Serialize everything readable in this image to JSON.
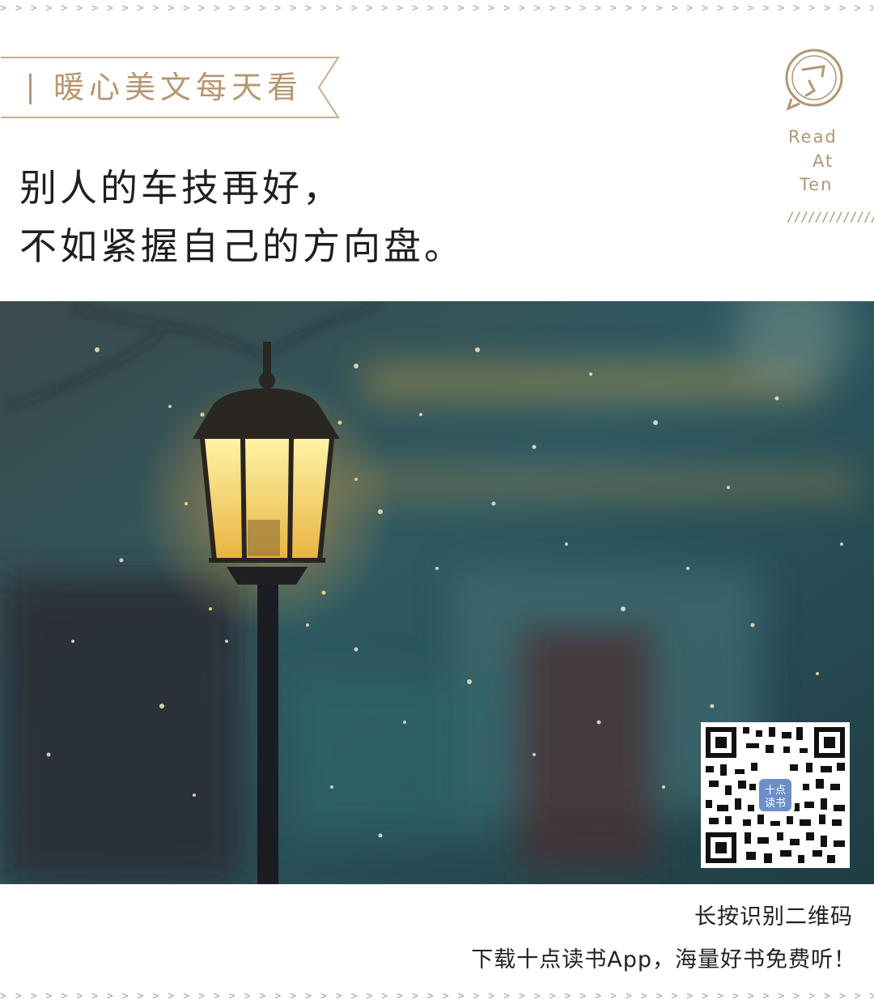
{
  "header": {
    "tag_text": "暖心美文每天看"
  },
  "quote": {
    "line1": "别人的车技再好，",
    "line2": "不如紧握自己的方向盘。"
  },
  "brand": {
    "word1": "Read",
    "word2": "At",
    "word3": "Ten",
    "slashes": "//////////////"
  },
  "qr": {
    "center_label": "十点读书"
  },
  "footer": {
    "line1": "长按识别二维码",
    "line2": "下载十点读书App，海量好书免费听！"
  },
  "colors": {
    "accent": "#b89670",
    "text": "#1f1f1f",
    "dash": "#a3a3a3"
  }
}
